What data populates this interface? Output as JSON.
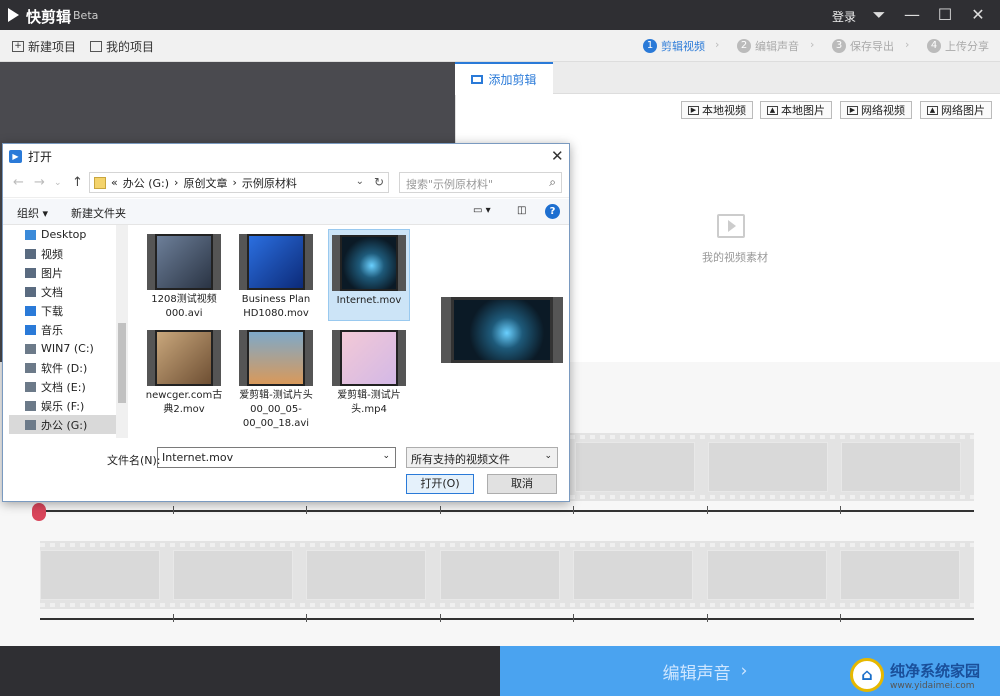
{
  "app": {
    "name": "快剪辑",
    "beta": "Beta",
    "login": "登录"
  },
  "toolbar": {
    "new_project": "新建项目",
    "my_projects": "我的项目"
  },
  "steps": [
    {
      "num": "1",
      "label": "剪辑视频"
    },
    {
      "num": "2",
      "label": "编辑声音"
    },
    {
      "num": "3",
      "label": "保存导出"
    },
    {
      "num": "4",
      "label": "上传分享"
    }
  ],
  "right_panel": {
    "tab": "添加剪辑",
    "buttons": [
      "本地视频",
      "本地图片",
      "网络视频",
      "网络图片"
    ],
    "empty_label": "我的视频素材"
  },
  "bottom": {
    "next_label": "编辑声音",
    "next_chevron": "›"
  },
  "watermark": {
    "line1": "纯净系统家园",
    "line2": "www.yidaimei.com"
  },
  "dialog": {
    "title": "打开",
    "breadcrumb": [
      "«",
      "办公 (G:)",
      "›",
      "原创文章",
      "›",
      "示例原材料"
    ],
    "search_placeholder": "搜索\"示例原材料\"",
    "organize": "组织 ▾",
    "new_folder": "新建文件夹",
    "nav": [
      {
        "label": "Desktop",
        "color": "#3b8ad9"
      },
      {
        "label": "视频",
        "color": "#5a6b80"
      },
      {
        "label": "图片",
        "color": "#5a6b80"
      },
      {
        "label": "文档",
        "color": "#5a6b80"
      },
      {
        "label": "下载",
        "color": "#2a7ad8"
      },
      {
        "label": "音乐",
        "color": "#2a7ad8"
      },
      {
        "label": "WIN7 (C:)",
        "color": "#6c7a89"
      },
      {
        "label": "软件 (D:)",
        "color": "#6c7a89"
      },
      {
        "label": "文档 (E:)",
        "color": "#6c7a89"
      },
      {
        "label": "娱乐 (F:)",
        "color": "#6c7a89"
      },
      {
        "label": "办公 (G:)",
        "color": "#6c7a89"
      }
    ],
    "files": [
      {
        "name": "1208测试视频000.avi",
        "thumb": "#4a5a6e"
      },
      {
        "name": "Business Plan HD1080.mov",
        "thumb": "#1b4fb4"
      },
      {
        "name": "Internet.mov",
        "thumb": "#123a55"
      },
      {
        "name": "newcger.com古典2.mov",
        "thumb": "#9c7f5e"
      },
      {
        "name": "爱剪辑-测试片头00_00_05-00_00_18.avi",
        "thumb": "#c98a50"
      },
      {
        "name": "爱剪辑-测试片头.mp4",
        "thumb": "#e6b6c8"
      }
    ],
    "filename_label": "文件名(N):",
    "filename_value": "Internet.mov",
    "filter_value": "所有支持的视频文件",
    "open_label": "打开(O)",
    "cancel_label": "取消"
  }
}
